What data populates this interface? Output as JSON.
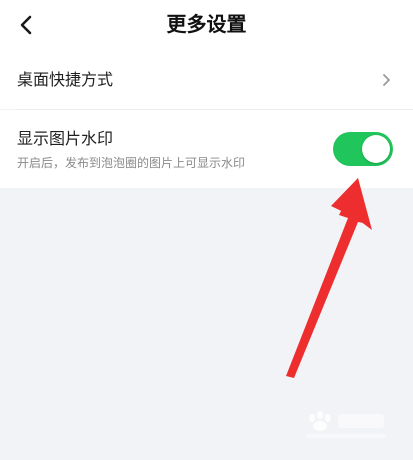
{
  "header": {
    "title": "更多设置"
  },
  "settings": {
    "shortcut": {
      "label": "桌面快捷方式"
    },
    "watermark": {
      "label": "显示图片水印",
      "description": "开启后，发布到泡泡圈的图片上可显示水印",
      "enabled": true
    }
  },
  "colors": {
    "toggle_on": "#20c55b",
    "arrow": "#ee2e2e",
    "background": "#f2f3f7"
  },
  "icons": {
    "back": "chevron-left-icon",
    "shortcut": "chevron-right-icon"
  }
}
